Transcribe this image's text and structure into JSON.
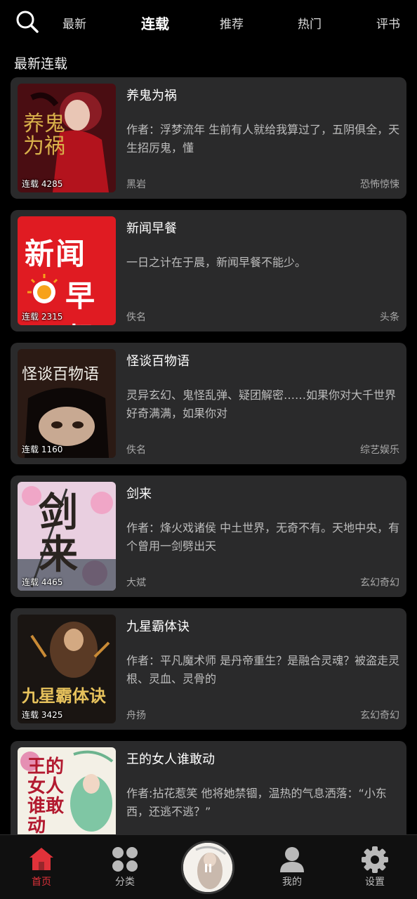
{
  "header": {
    "tabs": [
      {
        "label": "最新"
      },
      {
        "label": "连载"
      },
      {
        "label": "推荐"
      },
      {
        "label": "热门"
      },
      {
        "label": "评书"
      }
    ],
    "active_tab": "连载"
  },
  "section": {
    "title": "最新连载"
  },
  "books": [
    {
      "title": "养鬼为祸",
      "desc": "作者：浮梦流年   生前有人就给我算过了，五阴俱全，天生招厉鬼，懂",
      "author": "黑岩",
      "genre": "恐怖惊悚",
      "badge": "连载 4285"
    },
    {
      "title": "新闻早餐",
      "desc": "一日之计在于晨，新闻早餐不能少。",
      "author": "佚名",
      "genre": "头条",
      "badge": "连载 2315"
    },
    {
      "title": "怪谈百物语",
      "desc": "灵异玄幻、鬼怪乱弹、疑团解密……如果你对大千世界好奇满满，如果你对",
      "author": "佚名",
      "genre": "综艺娱乐",
      "badge": "连载 1160"
    },
    {
      "title": "剑来",
      "desc": "作者：烽火戏诸侯 中土世界，无奇不有。天地中央，有个曾用一剑劈出天",
      "author": "大斌",
      "genre": "玄幻奇幻",
      "badge": "连载 4465"
    },
    {
      "title": "九星霸体诀",
      "desc": "作者：平凡魔术师 是丹帝重生？是融合灵魂？被盗走灵根、灵血、灵骨的",
      "author": "舟扬",
      "genre": "玄幻奇幻",
      "badge": "连载 3425"
    },
    {
      "title": "王的女人谁敢动",
      "desc": "作者:拈花惹笑 他将她禁锢，温热的气息洒落：“小东西，还逃不逃？”",
      "author": "",
      "genre": "",
      "badge": ""
    }
  ],
  "covers": {
    "c1": {
      "text": "养鬼为祸",
      "bg": "#4a0d12"
    },
    "c2": {
      "line1": "新闻",
      "line2": "早餐",
      "bg": "#e01b22"
    },
    "c3": {
      "text": "怪谈百物语",
      "bg": "#2b1a14"
    },
    "c4": {
      "text": "剑来",
      "bg": "#e9cfe0"
    },
    "c5": {
      "text": "九星霸体诀",
      "bg": "#1a1512"
    },
    "c6": {
      "text": "王的女人谁敢动",
      "bg": "#f3f0e6"
    }
  },
  "bottom_nav": [
    {
      "label": "首页",
      "icon": "home-icon",
      "active": true
    },
    {
      "label": "分类",
      "icon": "grid-icon",
      "active": false
    },
    {
      "label": "我的",
      "icon": "user-icon",
      "active": false
    },
    {
      "label": "设置",
      "icon": "gear-icon",
      "active": false
    }
  ],
  "colors": {
    "accent": "#e0323a",
    "card": "#2a2a2b",
    "background": "#000000"
  }
}
